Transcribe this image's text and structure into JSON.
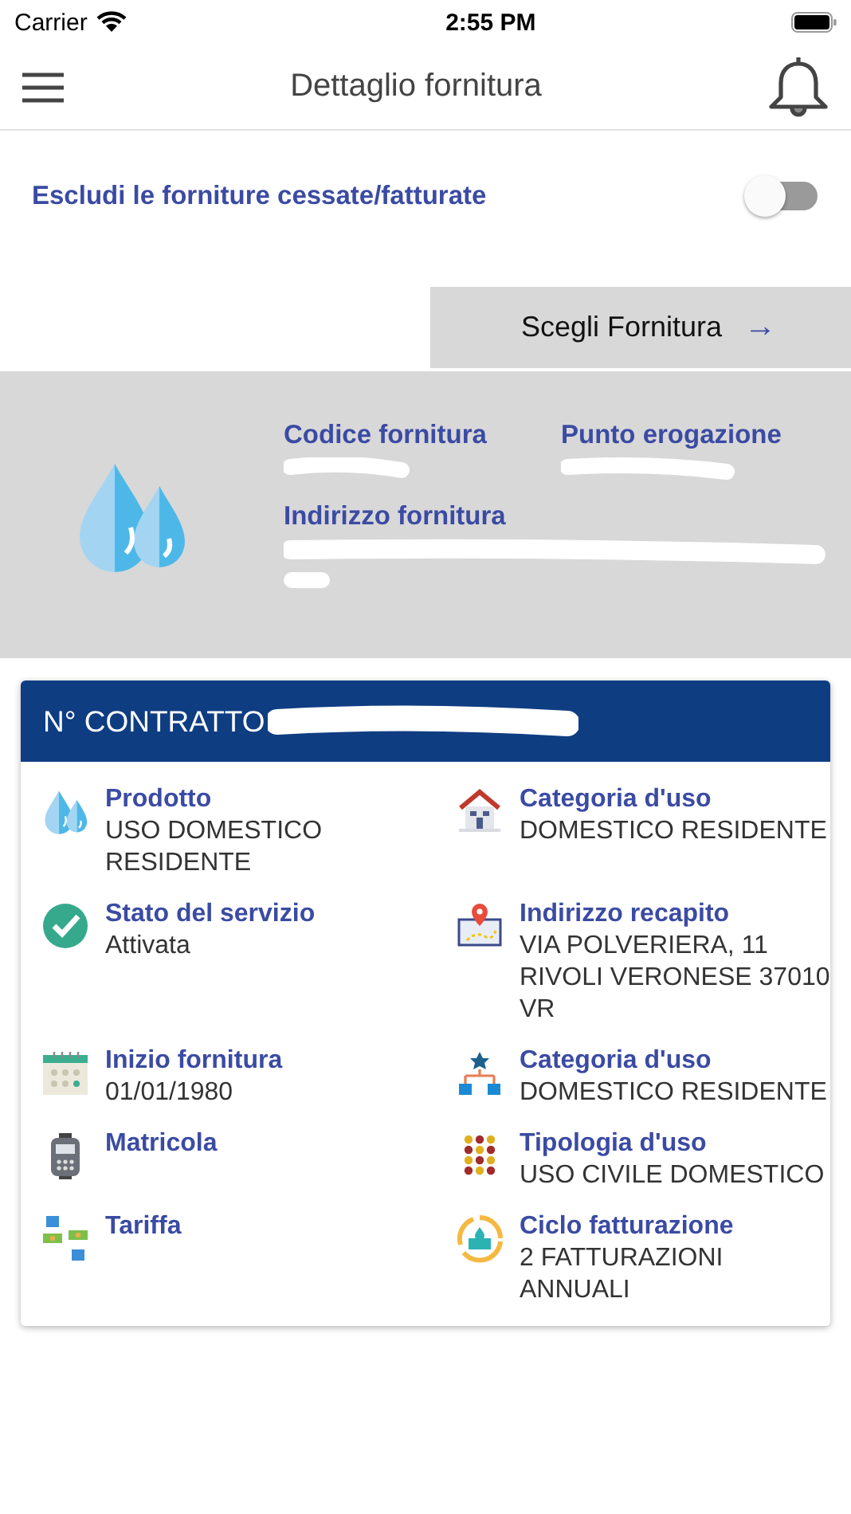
{
  "status_bar": {
    "carrier": "Carrier",
    "time": "2:55 PM"
  },
  "header": {
    "title": "Dettaglio fornitura"
  },
  "filter": {
    "label": "Escludi le forniture cessate/fatturate",
    "on": false
  },
  "choose_button": {
    "label": "Scegli Fornitura",
    "arrow": "→"
  },
  "supply": {
    "fields": [
      {
        "label": "Codice fornitura"
      },
      {
        "label": "Punto erogazione"
      },
      {
        "label": "Indirizzo fornitura"
      }
    ]
  },
  "contract": {
    "title": "N° CONTRATTO",
    "details": [
      {
        "kind": "drops",
        "label": "Prodotto",
        "value": "USO DOMESTICO RESIDENTE"
      },
      {
        "kind": "house",
        "label": "Categoria d'uso",
        "value": "DOMESTICO RESIDENTE"
      },
      {
        "kind": "check",
        "label": "Stato del servizio",
        "value": "Attivata"
      },
      {
        "kind": "map",
        "label": "Indirizzo recapito",
        "value": "VIA POLVERIERA, 11 RIVOLI VERONESE 37010 VR"
      },
      {
        "kind": "calendar",
        "label": "Inizio fornitura",
        "value": "01/01/1980"
      },
      {
        "kind": "hierarchy",
        "label": "Categoria d'uso",
        "value": "DOMESTICO RESIDENTE"
      },
      {
        "kind": "meter",
        "label": "Matricola"
      },
      {
        "kind": "dots",
        "label": "Tipologia d'uso",
        "value": "USO CIVILE DOMESTICO"
      },
      {
        "kind": "exchange",
        "label": "Tariffa"
      },
      {
        "kind": "cycle",
        "label": "Ciclo fatturazione",
        "value": "2 FATTURAZIONI ANNUALI"
      }
    ]
  }
}
